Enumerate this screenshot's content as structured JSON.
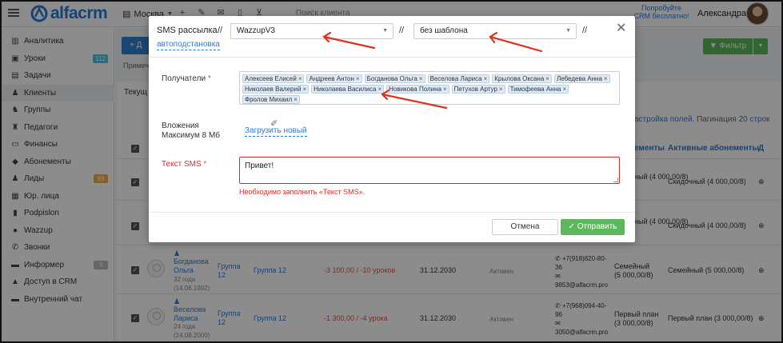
{
  "topbar": {
    "logo_text": "alfacrm",
    "branch": "Москва",
    "search_placeholder": "Поиск клиента",
    "promo": "Попробуйте CRM бесплатно!",
    "user_name": "Александра"
  },
  "sidebar": {
    "items": [
      {
        "label": "Аналитика",
        "icon": "chart-icon"
      },
      {
        "label": "Уроки",
        "icon": "calendar-icon",
        "badge": "112",
        "badge_color": "#5bc0de"
      },
      {
        "label": "Задачи",
        "icon": "tasks-icon"
      },
      {
        "label": "Клиенты",
        "icon": "user-icon"
      },
      {
        "label": "Группы",
        "icon": "group-icon"
      },
      {
        "label": "Педагоги",
        "icon": "teacher-icon"
      },
      {
        "label": "Финансы",
        "icon": "money-icon"
      },
      {
        "label": "Абонементы",
        "icon": "ticket-icon"
      },
      {
        "label": "Лиды",
        "icon": "leads-icon",
        "badge": "69",
        "badge_color": "#f0ad4e"
      },
      {
        "label": "Юр. лица",
        "icon": "building-icon"
      },
      {
        "label": "Podpislon",
        "icon": "document-icon"
      },
      {
        "label": "Wazzup",
        "icon": "whatsapp-icon"
      },
      {
        "label": "Звонки",
        "icon": "phone-icon"
      },
      {
        "label": "Информер",
        "icon": "informer-icon",
        "badge": "3",
        "badge_color": "#bbbbbb"
      },
      {
        "label": "Доступ в CRM",
        "icon": "lock-icon"
      },
      {
        "label": "Внутренний чат",
        "icon": "chat-icon"
      }
    ]
  },
  "background": {
    "add_button": "+ Д",
    "note": "Примеч",
    "filter_button": "▼ Фильтр",
    "tab_current": "Текущ",
    "fields_link": "астройка полей.",
    "pagination_label": "Пагинация",
    "pagination_value": "20 строк",
    "col_abonements": "ементы",
    "col_active_abonements": "Активные абонементы",
    "col_last": "Д",
    "rows": [
      {
        "abon": "ный (4 000,00/8)",
        "active": "Скидочный (4 000,00/8)"
      },
      {
        "abon": "ный (4 000,00/8)",
        "active": "Скидочный (4 000,00/8)"
      },
      {
        "name1": "Богданова",
        "name2": "Ольга",
        "age": "32 года",
        "dob": "(14.06.1992)",
        "group_a": "Группа",
        "group_b": "12",
        "group": "Группа 12",
        "balance": "-3 100,00 / -10 уроков",
        "date": "31.12.2030",
        "status": "Активен",
        "phone1": "+7(918)820-80-",
        "phone2": "36",
        "email": "9853@alfacrm.pro",
        "abon1": "Семейный",
        "abon2": "(5 000,00/8)",
        "active": "Семейный (5 000,00/8)"
      },
      {
        "name1": "Веселова",
        "name2": "Лариса",
        "age": "24 года",
        "dob": "(24.08.2000)",
        "group_a": "Группа",
        "group_b": "12",
        "group": "Группа 12",
        "balance": "-1 300,00 / -4 урока",
        "date": "31.12.2030",
        "status": "Активен",
        "phone1": "+7(968)094-40-",
        "phone2": "96",
        "email": "3050@alfacrm.pro",
        "abon1": "Первый план",
        "abon2": "(3 000,00/8)",
        "active": "Первый план (3 000,00/8)"
      }
    ]
  },
  "modal": {
    "title": "SMS рассылка",
    "separator": "//",
    "channel_value": "WazzupV3",
    "template_value": "без шаблона",
    "autosubstitution": "автоподстановка",
    "recipients_label": "Получатели",
    "required_mark": "*",
    "recipients": [
      "Алексеев Елисей",
      "Андреев Антон",
      "Богданова Ольга",
      "Веселова Лариса",
      "Крылова Оксана",
      "Лебедева Анна",
      "Николаев Валерий",
      "Николаева Василиса",
      "Новикова Полина",
      "Петухов Артур",
      "Тимофеева Анна",
      "Фролов Михаил"
    ],
    "attachments_label1": "Вложения",
    "attachments_label2": "Максимум 8 Мб",
    "upload_link": "Загрузить новый",
    "sms_text_label": "Текст SMS",
    "sms_text_value": "Привет!",
    "error_message": "Необходимо заполнить «Текст SMS».",
    "cancel_button": "Отмена",
    "send_button": "✓ Отправить"
  },
  "colors": {
    "accent": "#2b7bd4",
    "success": "#5cb85c",
    "error": "#c9302c",
    "annotation_arrow": "#e0301e"
  }
}
